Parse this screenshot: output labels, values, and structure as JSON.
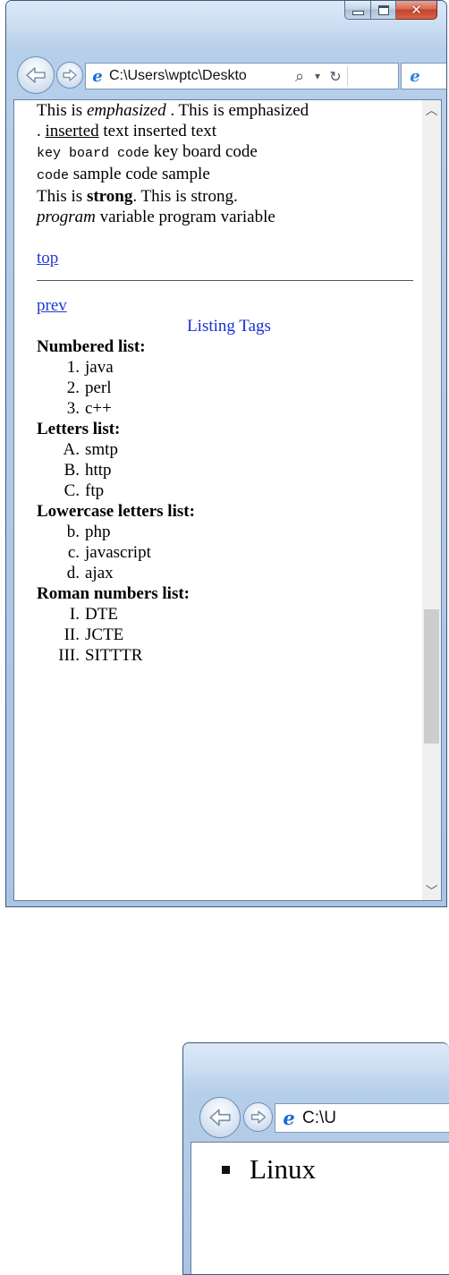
{
  "window1": {
    "address": "C:\\Users\\wptc\\Deskto",
    "search_glyph": "⌕",
    "dropdown_glyph": "▾",
    "refresh_glyph": "↻",
    "content": {
      "line_emph_1": "This is ",
      "emph_word": "emphasized",
      "line_emph_2": " . This is emphasized",
      "line_ins_1": ". ",
      "ins_word": "inserted",
      "line_ins_2": " text inserted text",
      "kbd_word": "key board code",
      "kbd_rest": " key board code",
      "code_word": "code",
      "code_rest": " sample code sample",
      "strong_1": "This is ",
      "strong_word": "strong",
      "strong_2": ". This is strong.",
      "var_word": "program",
      "var_rest": " variable program variable",
      "top_link": "top",
      "prev_link": "prev",
      "section_title": "Listing Tags",
      "numbered": {
        "heading": "Numbered list:",
        "items": [
          {
            "marker": "1.",
            "text": "java"
          },
          {
            "marker": "2.",
            "text": "perl"
          },
          {
            "marker": "3.",
            "text": "c++"
          }
        ]
      },
      "letters": {
        "heading": "Letters list:",
        "items": [
          {
            "marker": "A.",
            "text": "smtp"
          },
          {
            "marker": "B.",
            "text": "http"
          },
          {
            "marker": "C.",
            "text": "ftp"
          }
        ]
      },
      "lowercase": {
        "heading": "Lowercase letters list:",
        "items": [
          {
            "marker": "b.",
            "text": "php"
          },
          {
            "marker": "c.",
            "text": "javascript"
          },
          {
            "marker": "d.",
            "text": "ajax"
          }
        ]
      },
      "roman": {
        "heading": "Roman numbers list:",
        "items": [
          {
            "marker": "I.",
            "text": "DTE"
          },
          {
            "marker": "II.",
            "text": "JCTE"
          },
          {
            "marker": "III.",
            "text": "SITTTR"
          }
        ]
      }
    },
    "scroll_position_fraction": 0.78
  },
  "window2": {
    "address": "C:\\U",
    "list_item": "Linux"
  },
  "icons": {
    "back": "back-arrow-icon",
    "forward": "forward-arrow-icon",
    "page": "ie-page-icon",
    "search": "search-icon",
    "refresh": "refresh-icon",
    "minimize": "minimize-icon",
    "maximize": "maximize-icon",
    "close": "close-icon"
  },
  "colors": {
    "link": "#1f3ccf",
    "heading_blue": "#1a2ed4",
    "close_red": "#c3442b",
    "chrome_blue": "#b6cfea"
  }
}
